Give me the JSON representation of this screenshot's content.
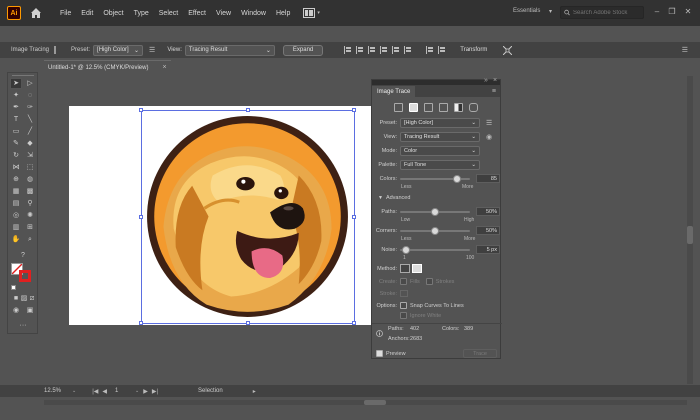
{
  "menubar": {
    "app_logo": "Ai",
    "menus": [
      "File",
      "Edit",
      "Object",
      "Type",
      "Select",
      "Effect",
      "View",
      "Window",
      "Help"
    ],
    "workspace": "Essentials",
    "search_placeholder": "Search Adobe Stock"
  },
  "controlbar": {
    "mode_label": "Image Tracing",
    "preset_label": "Preset:",
    "preset_value": "[High Color]",
    "view_label": "View:",
    "view_value": "Tracing Result",
    "expand_label": "Expand",
    "transform_label": "Transform"
  },
  "document": {
    "tab_title": "Untitled-1* @ 12.5% (CMYK/Preview)"
  },
  "image_trace": {
    "tab_title": "Image Trace",
    "preset_icons": [
      "auto-color-icon",
      "high-color-icon",
      "low-color-icon",
      "grayscale-icon",
      "black-and-white-icon",
      "outline-icon"
    ],
    "preset": {
      "label": "Preset:",
      "value": "[High Color]"
    },
    "view": {
      "label": "View:",
      "value": "Tracing Result"
    },
    "mode": {
      "label": "Mode:",
      "value": "Color"
    },
    "palette": {
      "label": "Palette:",
      "value": "Full Tone"
    },
    "colors": {
      "label": "Colors:",
      "value": "85",
      "level": 0.85,
      "min_label": "Less",
      "max_label": "More"
    },
    "advanced_label": "Advanced",
    "paths": {
      "label": "Paths:",
      "value": "50%",
      "level": 0.5,
      "min_label": "Low",
      "max_label": "High"
    },
    "corners": {
      "label": "Corners:",
      "value": "50%",
      "level": 0.5,
      "min_label": "Less",
      "max_label": "More"
    },
    "noise": {
      "label": "Noise:",
      "value": "5 px",
      "level": 0.04,
      "min_label": "1",
      "max_label": "100"
    },
    "method_label": "Method:",
    "create_label": "Create:",
    "fills_label": "Fills",
    "strokes_label": "Strokes",
    "stroke_label": "Stroke:",
    "options_label": "Options:",
    "snap_curves_label": "Snap Curves To Lines",
    "ignore_white_label": "Ignore White",
    "stats": {
      "paths_label": "Paths:",
      "paths_value": "402",
      "colors_label": "Colors:",
      "colors_value": "389",
      "anchors_label": "Anchors:",
      "anchors_value": "2683"
    },
    "preview_label": "Preview",
    "trace_button": "Trace"
  },
  "statusbar": {
    "zoom": "12.5%",
    "artboard_number": "1",
    "tool_name": "Selection"
  },
  "colors": {
    "app_bg": "#535353",
    "menubar_bg": "#323232",
    "logo_orange": "#ff9a00",
    "dog_circle_orange": "#f39a2e",
    "dog_circle_ring": "#4a2a1a",
    "dog_fur": "#f2c066",
    "selection_blue": "#5b6ee1"
  }
}
